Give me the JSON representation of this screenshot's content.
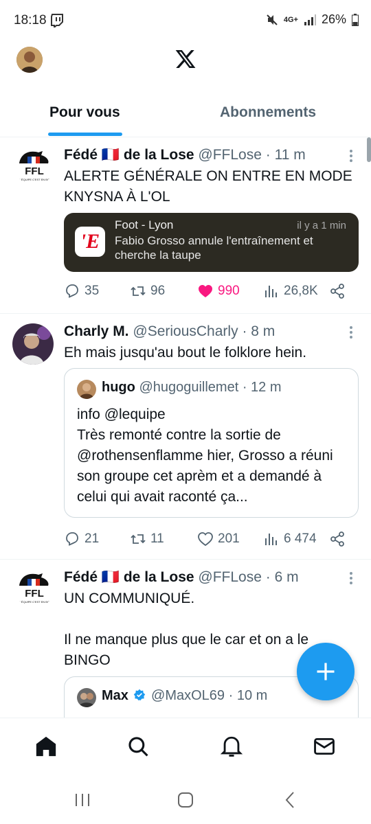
{
  "status_bar": {
    "time": "18:18",
    "network": "4G+",
    "battery": "26%"
  },
  "header": {
    "logo": "x-logo-icon"
  },
  "tabs": [
    {
      "label": "Pour vous",
      "active": true
    },
    {
      "label": "Abonnements",
      "active": false
    }
  ],
  "tweets": [
    {
      "name": "Fédé",
      "flag": "🇫🇷",
      "name_rest": "de la Lose",
      "handle": "@FFLose",
      "time": "· 11 m",
      "text": "ALERTE GÉNÉRALE ON ENTRE EN MODE KNYSNA À L'OL",
      "embed": {
        "app": "Foot - Lyon",
        "time": "il y a 1 min",
        "body": "Fabio Grosso annule l'entraînement et cherche la taupe",
        "icon_letter": "'E"
      },
      "replies": "35",
      "retweets": "96",
      "likes": "990",
      "views": "26,8K",
      "liked": true
    },
    {
      "name": "Charly M.",
      "handle": "@SeriousCharly",
      "time": "· 8 m",
      "text": "Eh mais jusqu'au bout le folklore hein.",
      "quote": {
        "name": "hugo",
        "handle": "@hugoguillemet",
        "time": "· 12 m",
        "text": "info @lequipe\nTrès remonté contre la sortie de @rothensenflamme hier, Grosso a réuni son groupe cet aprèm et a demandé à celui qui avait raconté ça..."
      },
      "replies": "21",
      "retweets": "11",
      "likes": "201",
      "views": "6 474",
      "liked": false
    },
    {
      "name": "Fédé",
      "flag": "🇫🇷",
      "name_rest": "de la Lose",
      "handle": "@FFLose",
      "time": "· 6 m",
      "text": "UN COMMUNIQUÉ.\n\nIl ne manque plus que le car et on a le BINGO",
      "quote": {
        "name": "Max",
        "handle": "@MaxOL69",
        "time": "· 10 m",
        "verified": true
      }
    }
  ],
  "ffl_logo": {
    "letters": "FFL",
    "tagline": "L'ÉQUIPE C'EST EN BO"
  },
  "fab": {
    "icon": "plus-icon"
  },
  "bottom_nav": [
    "home-icon",
    "search-icon",
    "notifications-icon",
    "messages-icon"
  ],
  "colors": {
    "accent": "#1d9bf0",
    "like": "#f91880",
    "text": "#0f1419",
    "secondary": "#536471"
  }
}
